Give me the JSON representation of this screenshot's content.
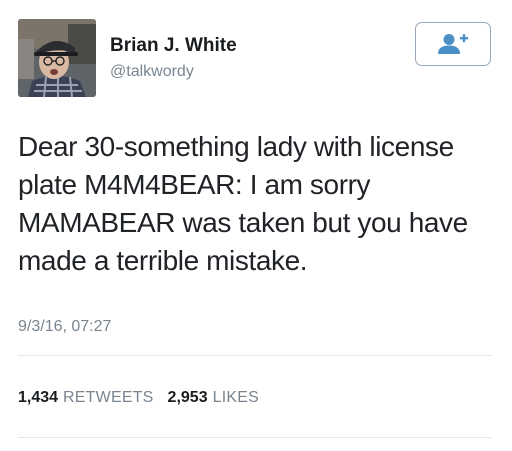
{
  "user": {
    "name": "Brian J. White",
    "handle": "@talkwordy"
  },
  "follow_button": {
    "icon": "add-user-icon",
    "color": "#4a90c6"
  },
  "tweet": {
    "text": "Dear 30-something lady with license plate M4M4BEAR: I am sorry MAMABEAR was taken but you have made a terrible mistake.",
    "timestamp": "9/3/16, 07:27"
  },
  "stats": {
    "retweets_count": "1,434",
    "retweets_label": "RETWEETS",
    "likes_count": "2,953",
    "likes_label": "LIKES"
  }
}
